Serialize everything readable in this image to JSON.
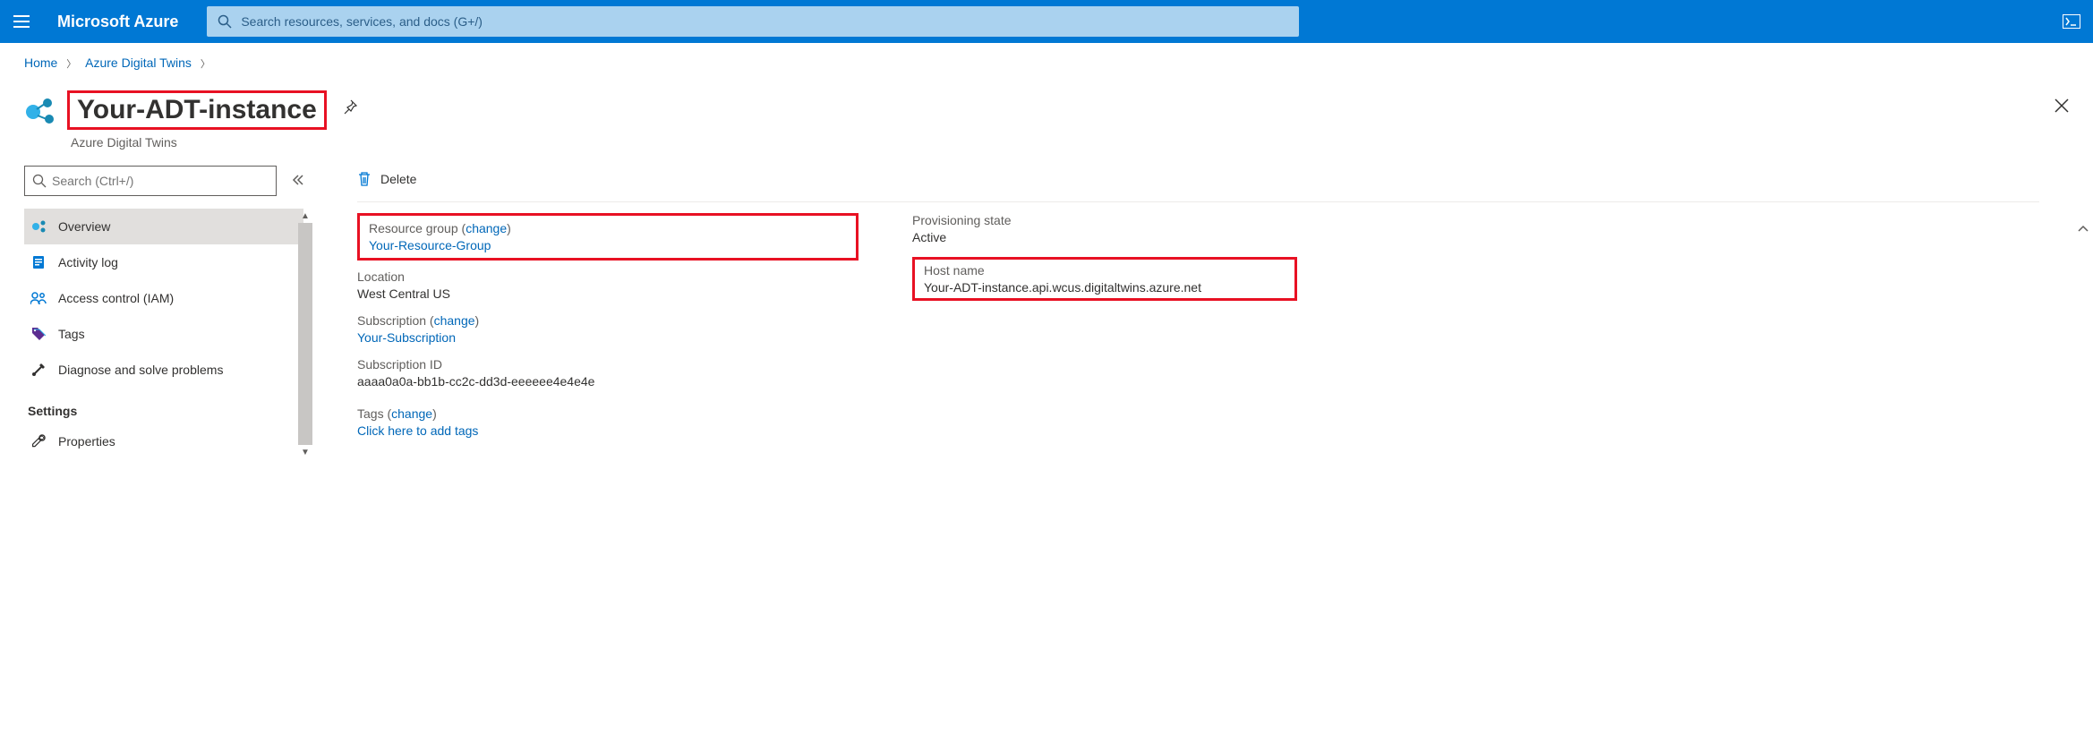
{
  "brand": "Microsoft Azure",
  "search": {
    "placeholder": "Search resources, services, and docs (G+/)"
  },
  "breadcrumb": {
    "home": "Home",
    "parent": "Azure Digital Twins"
  },
  "title": "Your-ADT-instance",
  "subtitle": "Azure Digital Twins",
  "menuSearch": {
    "placeholder": "Search (Ctrl+/)"
  },
  "nav": {
    "overview": "Overview",
    "activity": "Activity log",
    "iam": "Access control (IAM)",
    "tags": "Tags",
    "diagnose": "Diagnose and solve problems",
    "settingsHeading": "Settings",
    "properties": "Properties"
  },
  "toolbar": {
    "delete": "Delete"
  },
  "fields": {
    "resourceGroupLabel": "Resource group",
    "changeLink": "change",
    "resourceGroupValue": "Your-Resource-Group",
    "locationLabel": "Location",
    "locationValue": "West Central US",
    "subscriptionLabel": "Subscription",
    "subscriptionValue": "Your-Subscription",
    "subscriptionIdLabel": "Subscription ID",
    "subscriptionIdValue": "aaaa0a0a-bb1b-cc2c-dd3d-eeeeee4e4e4e",
    "tagsLabel": "Tags",
    "tagsValue": "Click here to add tags",
    "provisioningLabel": "Provisioning state",
    "provisioningValue": "Active",
    "hostnameLabel": "Host name",
    "hostnameValue": "Your-ADT-instance.api.wcus.digitaltwins.azure.net"
  }
}
